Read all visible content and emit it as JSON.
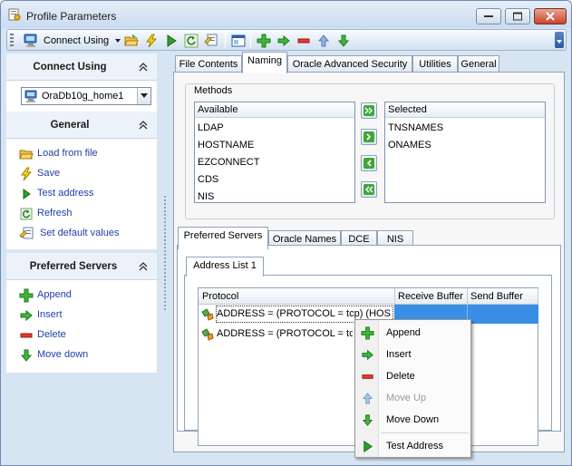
{
  "window": {
    "title": "Profile Parameters"
  },
  "toolbar": {
    "connect_label": "Connect Using"
  },
  "sidebar": {
    "connect_section": {
      "title": "Connect Using",
      "selected": "OraDb10g_home1"
    },
    "general_section": {
      "title": "General",
      "items": [
        {
          "label": "Load from file"
        },
        {
          "label": "Save"
        },
        {
          "label": "Test address"
        },
        {
          "label": "Refresh"
        },
        {
          "label": "Set default values"
        }
      ]
    },
    "servers_section": {
      "title": "Preferred Servers",
      "items": [
        {
          "label": "Append"
        },
        {
          "label": "Insert"
        },
        {
          "label": "Delete"
        },
        {
          "label": "Move down"
        }
      ]
    }
  },
  "tabs": [
    {
      "label": "File Contents"
    },
    {
      "label": "Naming"
    },
    {
      "label": "Oracle Advanced Security"
    },
    {
      "label": "Utilities"
    },
    {
      "label": "General"
    }
  ],
  "methods": {
    "group_label": "Methods",
    "available_header": "Available",
    "available": [
      "LDAP",
      "HOSTNAME",
      "EZCONNECT",
      "CDS",
      "NIS"
    ],
    "selected_header": "Selected",
    "selected": [
      "TNSNAMES",
      "ONAMES"
    ]
  },
  "subtabs": [
    {
      "label": "Preferred Servers"
    },
    {
      "label": "Oracle Names"
    },
    {
      "label": "DCE"
    },
    {
      "label": "NIS"
    }
  ],
  "address_tab": {
    "label": "Address List 1"
  },
  "grid": {
    "columns": [
      "Protocol",
      "Receive Buffer",
      "Send Buffer"
    ],
    "rows": [
      {
        "protocol": "ADDRESS = (PROTOCOL = tcp) (HOS"
      },
      {
        "protocol": "ADDRESS = (PROTOCOL = tc"
      }
    ]
  },
  "context_menu": {
    "items": [
      {
        "label": "Append"
      },
      {
        "label": "Insert"
      },
      {
        "label": "Delete"
      },
      {
        "label": "Move Up"
      },
      {
        "label": "Move Down"
      },
      {
        "label": "Test Address"
      }
    ]
  },
  "colors": {
    "accent": "#3d8ee6",
    "link": "#1f3fa8",
    "selection": "#3a8ee6"
  }
}
